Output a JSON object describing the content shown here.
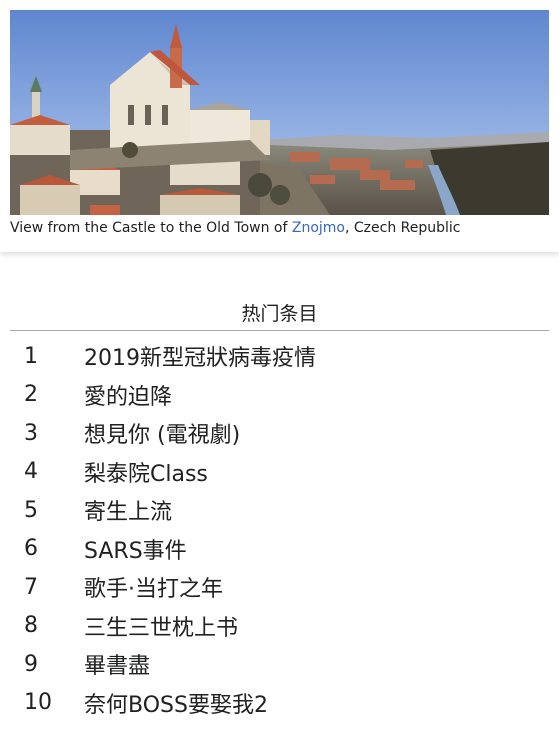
{
  "featured_image": {
    "caption_prefix": "View from the Castle to the Old Town of ",
    "caption_link": "Znojmo",
    "caption_suffix": ", Czech Republic",
    "link_color": "#3366cc"
  },
  "trending": {
    "title": "热门条目",
    "items": [
      {
        "rank": "1",
        "name": "2019新型冠狀病毒疫情"
      },
      {
        "rank": "2",
        "name": "愛的迫降"
      },
      {
        "rank": "3",
        "name": "想見你 (電視劇)"
      },
      {
        "rank": "4",
        "name": "梨泰院Class"
      },
      {
        "rank": "5",
        "name": "寄生上流"
      },
      {
        "rank": "6",
        "name": "SARS事件"
      },
      {
        "rank": "7",
        "name": "歌手·当打之年"
      },
      {
        "rank": "8",
        "name": "三生三世枕上书"
      },
      {
        "rank": "9",
        "name": "畢書盡"
      },
      {
        "rank": "10",
        "name": "奈何BOSS要娶我2"
      }
    ]
  }
}
